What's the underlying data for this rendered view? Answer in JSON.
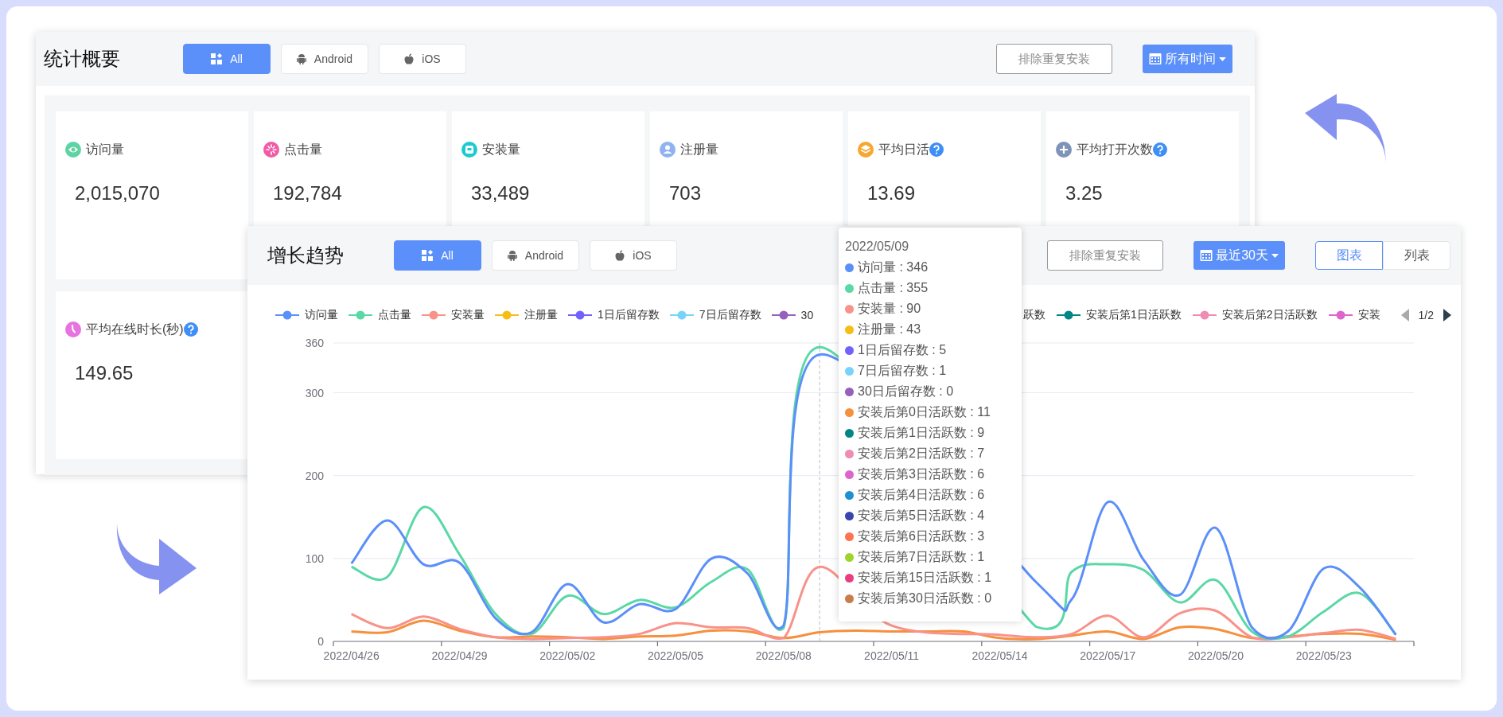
{
  "summary_panel": {
    "title": "统计概要",
    "platform_tabs": [
      {
        "label": "All",
        "selected": true
      },
      {
        "label": "Android",
        "selected": false
      },
      {
        "label": "iOS",
        "selected": false
      }
    ],
    "dedupe_button": "排除重复安装",
    "date_range": "所有时间",
    "stats": [
      {
        "label": "访问量",
        "value": "2,015,070",
        "color": "#5fd3a4",
        "help": false
      },
      {
        "label": "点击量",
        "value": "192,784",
        "color": "#f25aa6",
        "help": false
      },
      {
        "label": "安装量",
        "value": "33,489",
        "color": "#1ccbd0",
        "help": false
      },
      {
        "label": "注册量",
        "value": "703",
        "color": "#8fb3ee",
        "help": false
      },
      {
        "label": "平均日活",
        "value": "13.69",
        "color": "#f7a630",
        "help": true
      },
      {
        "label": "平均打开次数",
        "value": "3.25",
        "color": "#7d93b8",
        "help": true
      },
      {
        "label": "平均在线时长(秒)",
        "value": "149.65",
        "color": "#e673e0",
        "help": true
      }
    ]
  },
  "trend_panel": {
    "title": "增长趋势",
    "platform_tabs": [
      {
        "label": "All",
        "selected": true
      },
      {
        "label": "Android",
        "selected": false
      },
      {
        "label": "iOS",
        "selected": false
      }
    ],
    "dedupe_button": "排除重复安装",
    "date_range": "最近30天",
    "view_tabs": [
      {
        "label": "图表",
        "selected": true
      },
      {
        "label": "列表",
        "selected": false
      }
    ],
    "legend_left": [
      {
        "label": "注册量",
        "color": "#f6bd16"
      },
      {
        "label": "1日后留存数",
        "color": "#7262fd"
      },
      {
        "label": "7日后留存数",
        "color": "#78d3f8"
      },
      {
        "label": "30",
        "color": "#9661bc"
      }
    ],
    "legend_right": [
      {
        "label": "跃数"
      },
      {
        "label": "安装后第1日活跃数",
        "color": "#008685"
      },
      {
        "label": "安装后第2日活跃数",
        "color": "#f08bb4"
      },
      {
        "label": "安装",
        "color": "#dd66cc"
      }
    ],
    "legend_pager": {
      "page": "1/2",
      "prev_disabled": true,
      "next_disabled": false
    },
    "chart_data": {
      "type": "line",
      "grid": true,
      "ylim": [
        0,
        360
      ],
      "yticks": [
        0,
        100,
        200,
        300,
        360
      ],
      "categories": [
        "2022/04/26",
        null,
        null,
        "2022/04/29",
        null,
        null,
        "2022/05/02",
        null,
        null,
        "2022/05/05",
        null,
        null,
        "2022/05/08",
        null,
        null,
        "2022/05/11",
        null,
        null,
        "2022/05/14",
        null,
        null,
        "2022/05/17",
        null,
        null,
        "2022/05/20",
        null,
        null,
        "2022/05/23",
        null,
        null
      ],
      "series": [
        {
          "name": "访问量",
          "color": "#5b8ff9",
          "values": [
            94,
            146,
            93,
            95,
            28,
            11,
            69,
            23,
            45,
            39,
            100,
            82,
            19,
            346,
            null,
            null,
            null,
            null,
            null,
            72,
            51,
            168,
            98,
            56,
            137,
            17,
            12,
            88,
            65,
            8
          ]
        },
        {
          "name": "点击量",
          "color": "#5ad8a6",
          "values": [
            90,
            78,
            162,
            105,
            33,
            9,
            55,
            33,
            50,
            41,
            72,
            87,
            16,
            355,
            null,
            null,
            null,
            null,
            null,
            18,
            84,
            93,
            86,
            47,
            74,
            12,
            6,
            36,
            58,
            8
          ]
        },
        {
          "name": "安装量",
          "color": "#f8928a",
          "values": [
            33,
            16,
            30,
            15,
            5,
            3,
            4,
            5,
            9,
            22,
            17,
            16,
            4,
            90,
            null,
            19,
            null,
            null,
            8,
            5,
            9,
            31,
            5,
            34,
            37,
            5,
            5,
            10,
            14,
            3
          ]
        },
        {
          "color": "#f6903d",
          "values": [
            12,
            11,
            25,
            13,
            5,
            6,
            5,
            3,
            6,
            7,
            13,
            12,
            4,
            11,
            13,
            12,
            12,
            12,
            4,
            3,
            7,
            12,
            3,
            17,
            15,
            4,
            6,
            9,
            9,
            2
          ]
        }
      ]
    },
    "tooltip": {
      "title": "2022/05/09",
      "items": [
        {
          "text": "访问量 : 346",
          "color": "#5b8ff9"
        },
        {
          "text": "点击量 : 355",
          "color": "#5ad8a6"
        },
        {
          "text": "安装量 : 90",
          "color": "#f8928a"
        },
        {
          "text": "注册量 : 43",
          "color": "#f6bd16"
        },
        {
          "text": "1日后留存数 : 5",
          "color": "#7262fd"
        },
        {
          "text": "7日后留存数 : 1",
          "color": "#78d3f8"
        },
        {
          "text": "30日后留存数 : 0",
          "color": "#9661bc"
        },
        {
          "text": "安装后第0日活跃数 : 11",
          "color": "#f6903d"
        },
        {
          "text": "安装后第1日活跃数 : 9",
          "color": "#008685"
        },
        {
          "text": "安装后第2日活跃数 : 7",
          "color": "#f08bb4"
        },
        {
          "text": "安装后第3日活跃数 : 6",
          "color": "#dd66cc"
        },
        {
          "text": "安装后第4日活跃数 : 6",
          "color": "#1e90d0"
        },
        {
          "text": "安装后第5日活跃数 : 4",
          "color": "#3b45b0"
        },
        {
          "text": "安装后第6日活跃数 : 3",
          "color": "#ff7250"
        },
        {
          "text": "安装后第7日活跃数 : 1",
          "color": "#9fd42a"
        },
        {
          "text": "安装后第15日活跃数 : 1",
          "color": "#e8407f"
        },
        {
          "text": "安装后第30日活跃数 : 0",
          "color": "#c97e4a"
        }
      ]
    }
  }
}
